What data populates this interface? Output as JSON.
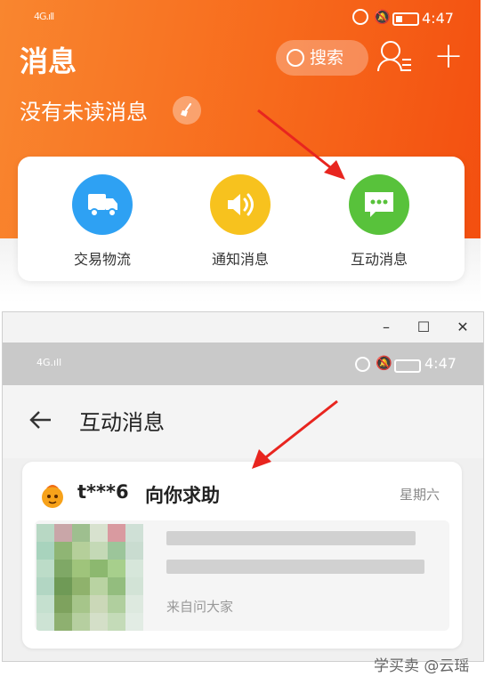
{
  "top_panel": {
    "status": {
      "signal": "4G.ıll",
      "time": "4:47"
    },
    "title": "消息",
    "search_label": "搜索",
    "unread_text": "没有未读消息",
    "categories": [
      {
        "label": "交易物流",
        "icon": "truck-icon",
        "color": "#2ea1f3"
      },
      {
        "label": "通知消息",
        "icon": "speaker-icon",
        "color": "#f7c21e"
      },
      {
        "label": "互动消息",
        "icon": "chat-bubble-icon",
        "color": "#58c23b"
      }
    ],
    "hero_color": "#f76a1c"
  },
  "window": {
    "controls": {
      "minimize": "–",
      "maximize": "☐",
      "close": "✕"
    },
    "status": {
      "signal": "4G.ıll",
      "time": "4:47"
    },
    "page_title": "互动消息",
    "message": {
      "sender": "t***6",
      "action": "向你求助",
      "date": "星期六",
      "source": "来自问大家"
    }
  },
  "watermark": "学买卖 @云瑶"
}
